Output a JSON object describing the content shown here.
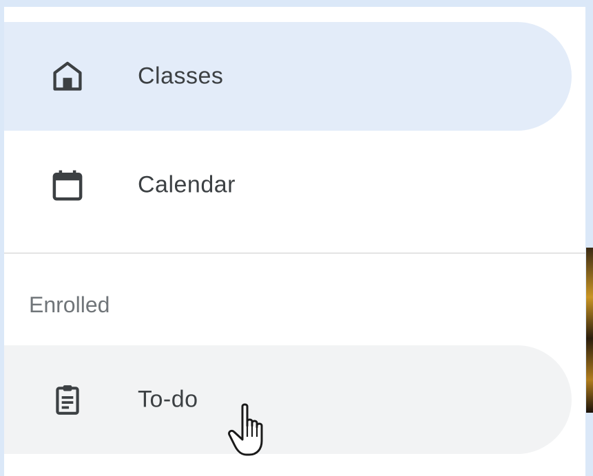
{
  "nav": {
    "items": [
      {
        "label": "Classes",
        "icon": "home-icon",
        "state": "selected"
      },
      {
        "label": "Calendar",
        "icon": "calendar-icon",
        "state": "default"
      }
    ]
  },
  "enrolled": {
    "header": "Enrolled",
    "items": [
      {
        "label": "To-do",
        "icon": "clipboard-icon",
        "state": "hovered"
      }
    ]
  },
  "colors": {
    "selected_bg": "#e3ecf9",
    "hover_bg": "#f2f3f4",
    "text": "#3c4043",
    "secondary_text": "#707579",
    "icon": "#3c4043"
  },
  "cursor": "hand-pointer-icon"
}
